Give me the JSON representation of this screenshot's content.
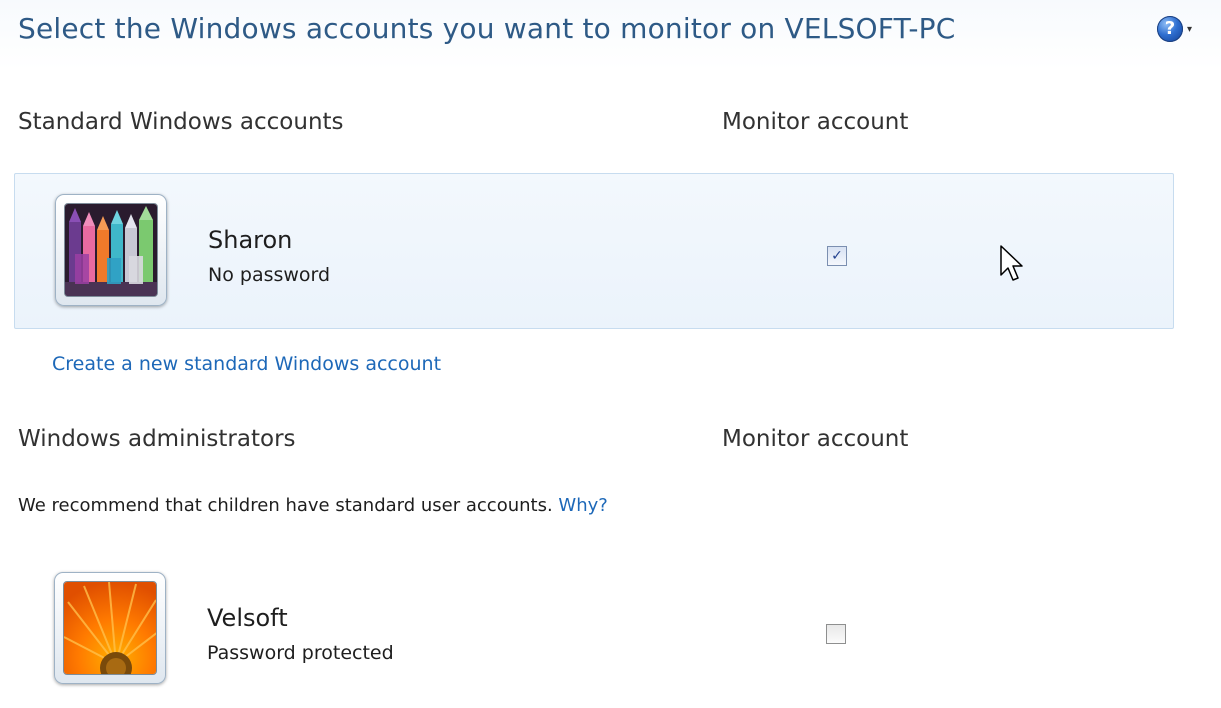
{
  "header": {
    "title": "Select the Windows accounts you want to monitor on VELSOFT-PC",
    "help_icon_glyph": "?",
    "help_caret_glyph": "▾"
  },
  "standard_section": {
    "heading": "Standard Windows accounts",
    "monitor_column": "Monitor account",
    "accounts": [
      {
        "name": "Sharon",
        "status": "No password",
        "avatar": "crayons-picture",
        "monitored": true,
        "selected": true
      }
    ],
    "create_link": "Create a new standard Windows account"
  },
  "admin_section": {
    "heading": "Windows administrators",
    "monitor_column": "Monitor account",
    "recommendation": "We recommend that children have standard user accounts.",
    "why_link": "Why?",
    "accounts": [
      {
        "name": "Velsoft",
        "status": "Password protected",
        "avatar": "orange-flower-picture",
        "monitored": false,
        "selected": false
      }
    ]
  },
  "check_mark_glyph": "✓",
  "colors": {
    "title": "#2e5a86",
    "link": "#1d68b8",
    "selected_row_border": "#c7dcef",
    "selected_row_bg": "#ebf3fb"
  }
}
